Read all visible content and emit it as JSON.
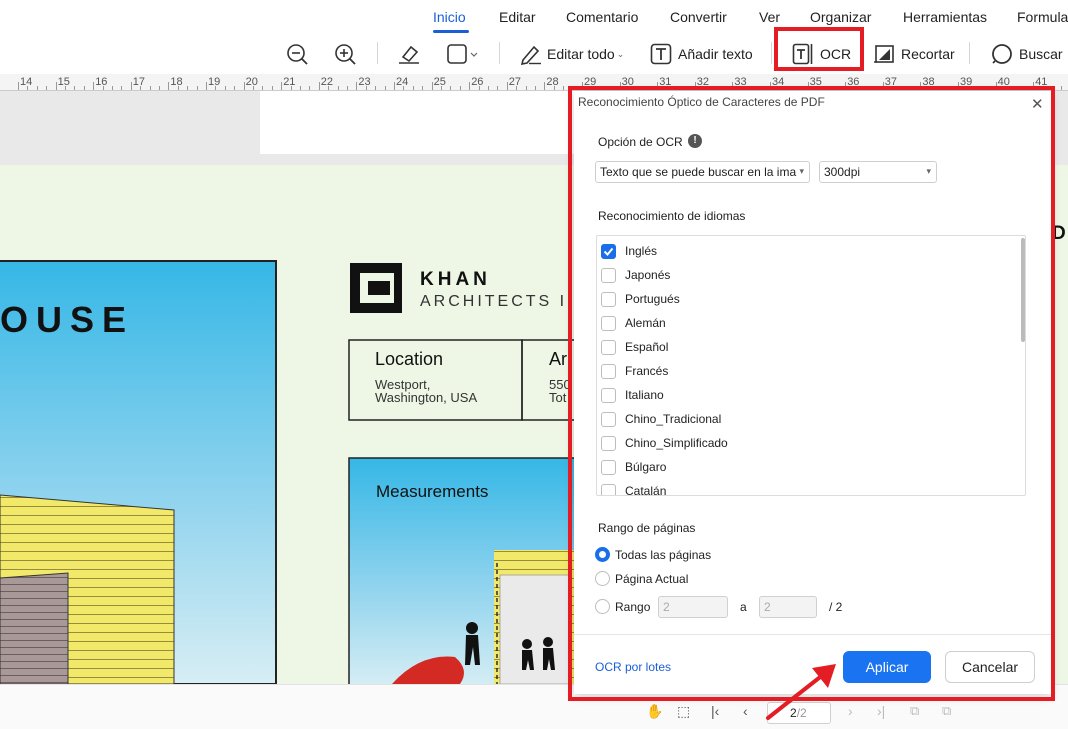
{
  "menu": {
    "items": [
      "Inicio",
      "Editar",
      "Comentario",
      "Convertir",
      "Ver",
      "Organizar",
      "Herramientas",
      "Formula"
    ],
    "active": "Inicio"
  },
  "toolbar": {
    "editar_todo": "Editar todo",
    "anadir_texto": "Añadir texto",
    "ocr": "OCR",
    "recortar": "Recortar",
    "buscar": "Buscar"
  },
  "ruler": {
    "ticks": [
      "14",
      "15",
      "16",
      "17",
      "18",
      "19",
      "20",
      "21",
      "22",
      "23",
      "24",
      "25",
      "26",
      "27",
      "28",
      "29",
      "30",
      "31",
      "32",
      "33",
      "34",
      "35",
      "36",
      "37",
      "38",
      "39",
      "40",
      "41"
    ]
  },
  "document": {
    "house_title": "OUSE",
    "brand_line1": "KHAN",
    "brand_line2": "ARCHITECTS I",
    "location_label": "Location",
    "location_value1": "Westport,",
    "location_value2": "Washington, USA",
    "col2_label": "Ar",
    "col2_value1": "550",
    "col2_value2": "Tot",
    "measurements": "Measurements",
    "right_letter": "D"
  },
  "dialog": {
    "title": "Reconocimiento Óptico de Caracteres de PDF",
    "ocr_option_label": "Opción de OCR",
    "ocr_mode": "Texto que se puede buscar en la ima",
    "dpi": "300dpi",
    "lang_label": "Reconocimiento de idiomas",
    "languages": [
      {
        "name": "Inglés",
        "checked": true
      },
      {
        "name": "Japonés",
        "checked": false
      },
      {
        "name": "Portugués",
        "checked": false
      },
      {
        "name": "Alemán",
        "checked": false
      },
      {
        "name": "Español",
        "checked": false
      },
      {
        "name": "Francés",
        "checked": false
      },
      {
        "name": "Italiano",
        "checked": false
      },
      {
        "name": "Chino_Tradicional",
        "checked": false
      },
      {
        "name": "Chino_Simplificado",
        "checked": false
      },
      {
        "name": "Búlgaro",
        "checked": false
      },
      {
        "name": "Catalán",
        "checked": false
      }
    ],
    "range_label": "Rango de páginas",
    "range_all": "Todas las páginas",
    "range_current": "Página Actual",
    "range_custom": "Rango",
    "range_from": "2",
    "range_a": "a",
    "range_to": "2",
    "range_total": "/ 2",
    "batch_link": "OCR por lotes",
    "apply": "Aplicar",
    "cancel": "Cancelar"
  },
  "statusbar": {
    "page_current": "2",
    "page_total": "/2"
  },
  "colors": {
    "accent": "#1a73f0",
    "highlight": "#e31d23"
  }
}
